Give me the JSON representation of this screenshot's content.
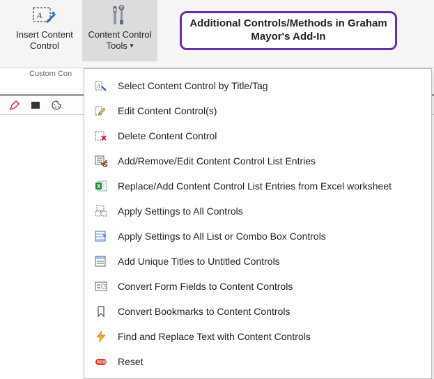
{
  "ribbon": {
    "insert_label_line1": "Insert Content",
    "insert_label_line2": "Control",
    "tools_label_line1": "Content Control",
    "tools_label_line2": "Tools",
    "group_label": "Custom Con"
  },
  "callout": {
    "text": "Additional Controls/Methods in Graham Mayor's Add-In"
  },
  "menu": {
    "items": [
      {
        "id": "select-by-title-tag",
        "label": "Select Content Control by Title/Tag",
        "icon": "select-title-tag"
      },
      {
        "id": "edit",
        "label": "Edit Content Control(s)",
        "icon": "edit-pencil"
      },
      {
        "id": "delete",
        "label": "Delete Content Control",
        "icon": "delete-x"
      },
      {
        "id": "list-entries",
        "label": "Add/Remove/Edit Content Control List Entries",
        "icon": "list-check"
      },
      {
        "id": "excel-replace",
        "label": "Replace/Add Content Control List Entries from Excel worksheet",
        "icon": "excel"
      },
      {
        "id": "apply-all",
        "label": "Apply Settings to All Controls",
        "icon": "apply-all"
      },
      {
        "id": "apply-list",
        "label": "Apply Settings to All List or Combo Box Controls",
        "icon": "apply-list"
      },
      {
        "id": "unique-titles",
        "label": "Add Unique Titles to Untitled Controls",
        "icon": "unique-titles"
      },
      {
        "id": "convert-form",
        "label": "Convert Form Fields to Content Controls",
        "icon": "convert-form"
      },
      {
        "id": "convert-bookmarks",
        "label": "Convert Bookmarks to Content Controls",
        "icon": "bookmark"
      },
      {
        "id": "find-replace",
        "label": "Find and Replace Text with Content Controls",
        "icon": "lightning"
      },
      {
        "id": "reset",
        "label": "Reset",
        "icon": "reset"
      }
    ]
  }
}
